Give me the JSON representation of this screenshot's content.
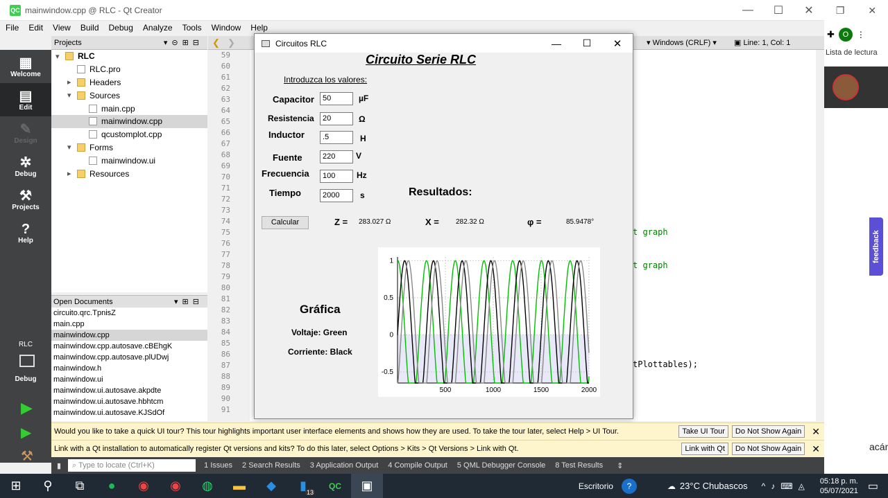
{
  "window": {
    "title": "mainwindow.cpp @ RLC - Qt Creator",
    "logo": "QC"
  },
  "menu": [
    "File",
    "Edit",
    "View",
    "Build",
    "Debug",
    "Analyze",
    "Tools",
    "Window",
    "Help"
  ],
  "modes": [
    {
      "label": "Welcome",
      "icon": "grid-icon"
    },
    {
      "label": "Edit",
      "icon": "edit-icon"
    },
    {
      "label": "Design",
      "icon": "pencil-icon"
    },
    {
      "label": "Debug",
      "icon": "bug-icon"
    },
    {
      "label": "Projects",
      "icon": "wrench-icon"
    },
    {
      "label": "Help",
      "icon": "help-icon"
    }
  ],
  "kit": {
    "name": "RLC",
    "mode": "Debug"
  },
  "projects": {
    "header": "Projects",
    "tree": [
      {
        "label": "RLC",
        "depth": 0,
        "arrow": "▾"
      },
      {
        "label": "RLC.pro",
        "depth": 1,
        "arrow": ""
      },
      {
        "label": "Headers",
        "depth": 1,
        "arrow": "▸"
      },
      {
        "label": "Sources",
        "depth": 1,
        "arrow": "▾"
      },
      {
        "label": "main.cpp",
        "depth": 2,
        "arrow": ""
      },
      {
        "label": "mainwindow.cpp",
        "depth": 2,
        "arrow": "",
        "selected": true
      },
      {
        "label": "qcustomplot.cpp",
        "depth": 2,
        "arrow": ""
      },
      {
        "label": "Forms",
        "depth": 1,
        "arrow": "▾"
      },
      {
        "label": "mainwindow.ui",
        "depth": 2,
        "arrow": ""
      },
      {
        "label": "Resources",
        "depth": 1,
        "arrow": "▸"
      }
    ]
  },
  "open_documents": {
    "header": "Open Documents",
    "items": [
      "circuito.qrc.TpnisZ",
      "main.cpp",
      "mainwindow.cpp",
      "mainwindow.cpp.autosave.cBEhgK",
      "mainwindow.cpp.autosave.plUDwj",
      "mainwindow.h",
      "mainwindow.ui",
      "mainwindow.ui.autosave.akpdte",
      "mainwindow.ui.autosave.hbhtcm",
      "mainwindow.ui.autosave.KJSdOf"
    ],
    "selected": 2
  },
  "editor": {
    "line_start": 59,
    "line_end": 91,
    "status_encoding": "Windows (CRLF)",
    "status_position": "Line: 1, Col: 1",
    "frag1": "t graph",
    "frag2": "t graph",
    "frag3": "tPlottables);"
  },
  "dialog": {
    "title": "Circuitos RLC",
    "heading": "Circuito Serie RLC",
    "intro": "Introduzca los valores:",
    "fields": [
      {
        "label": "Capacitor",
        "value": "50",
        "unit": "µF"
      },
      {
        "label": "Resistencia",
        "value": "20",
        "unit": "Ω"
      },
      {
        "label": "Inductor",
        "value": ".5",
        "unit": "H"
      },
      {
        "label": "Fuente",
        "value": "220",
        "unit": "V"
      },
      {
        "label": "Frecuencia",
        "value": "100",
        "unit": "Hz"
      },
      {
        "label": "Tiempo",
        "value": "2000",
        "unit": "s"
      }
    ],
    "results_title": "Resultados:",
    "button": "Calcular",
    "results": [
      {
        "symbol": "Z =",
        "value": "283.027 Ω"
      },
      {
        "symbol": "X =",
        "value": "282.32 Ω"
      },
      {
        "symbol": "φ =",
        "value": "85.9478°"
      }
    ],
    "graph_title": "Gráfica",
    "legend_v": "Voltaje: Green",
    "legend_i": "Corriente: Black"
  },
  "chart_data": {
    "type": "line",
    "xlim": [
      0,
      2000
    ],
    "ylim": [
      -0.65,
      1.05
    ],
    "xticks": [
      500,
      1000,
      1500,
      2000
    ],
    "yticks": [
      1,
      0.5,
      0,
      -0.5
    ],
    "period": 300,
    "series": [
      {
        "color": "#00c000",
        "phase": 1.5
      },
      {
        "color": "#000000",
        "phase": 0.0
      },
      {
        "color": "#888888",
        "phase": -0.8
      }
    ]
  },
  "tour_bar": {
    "text": "Would you like to take a quick UI tour? This tour highlights important user interface elements and shows how they are used. To take the tour later, select Help > UI Tour.",
    "btn1": "Take UI Tour",
    "btn2": "Do Not Show Again"
  },
  "link_bar": {
    "text": "Link with a Qt installation to automatically register Qt versions and kits? To do this later, select Options > Kits > Qt Versions > Link with Qt.",
    "btn1": "Link with Qt",
    "btn2": "Do Not Show Again"
  },
  "bottom": {
    "search_placeholder": "Type to locate (Ctrl+K)",
    "tabs": [
      "1  Issues",
      "2  Search Results",
      "3  Application Output",
      "4  Compile Output",
      "5  QML Debugger Console",
      "8  Test Results"
    ]
  },
  "browser": {
    "reading_list": "Lista de lectura",
    "feedback": "feedback",
    "snippet": "acán,",
    "avatar_letter": "O"
  },
  "taskbar": {
    "desktop": "Escritorio",
    "weather": "23°C  Chubascos",
    "time": "05:18 p. m.",
    "date": "05/07/2021",
    "badge": "13"
  }
}
